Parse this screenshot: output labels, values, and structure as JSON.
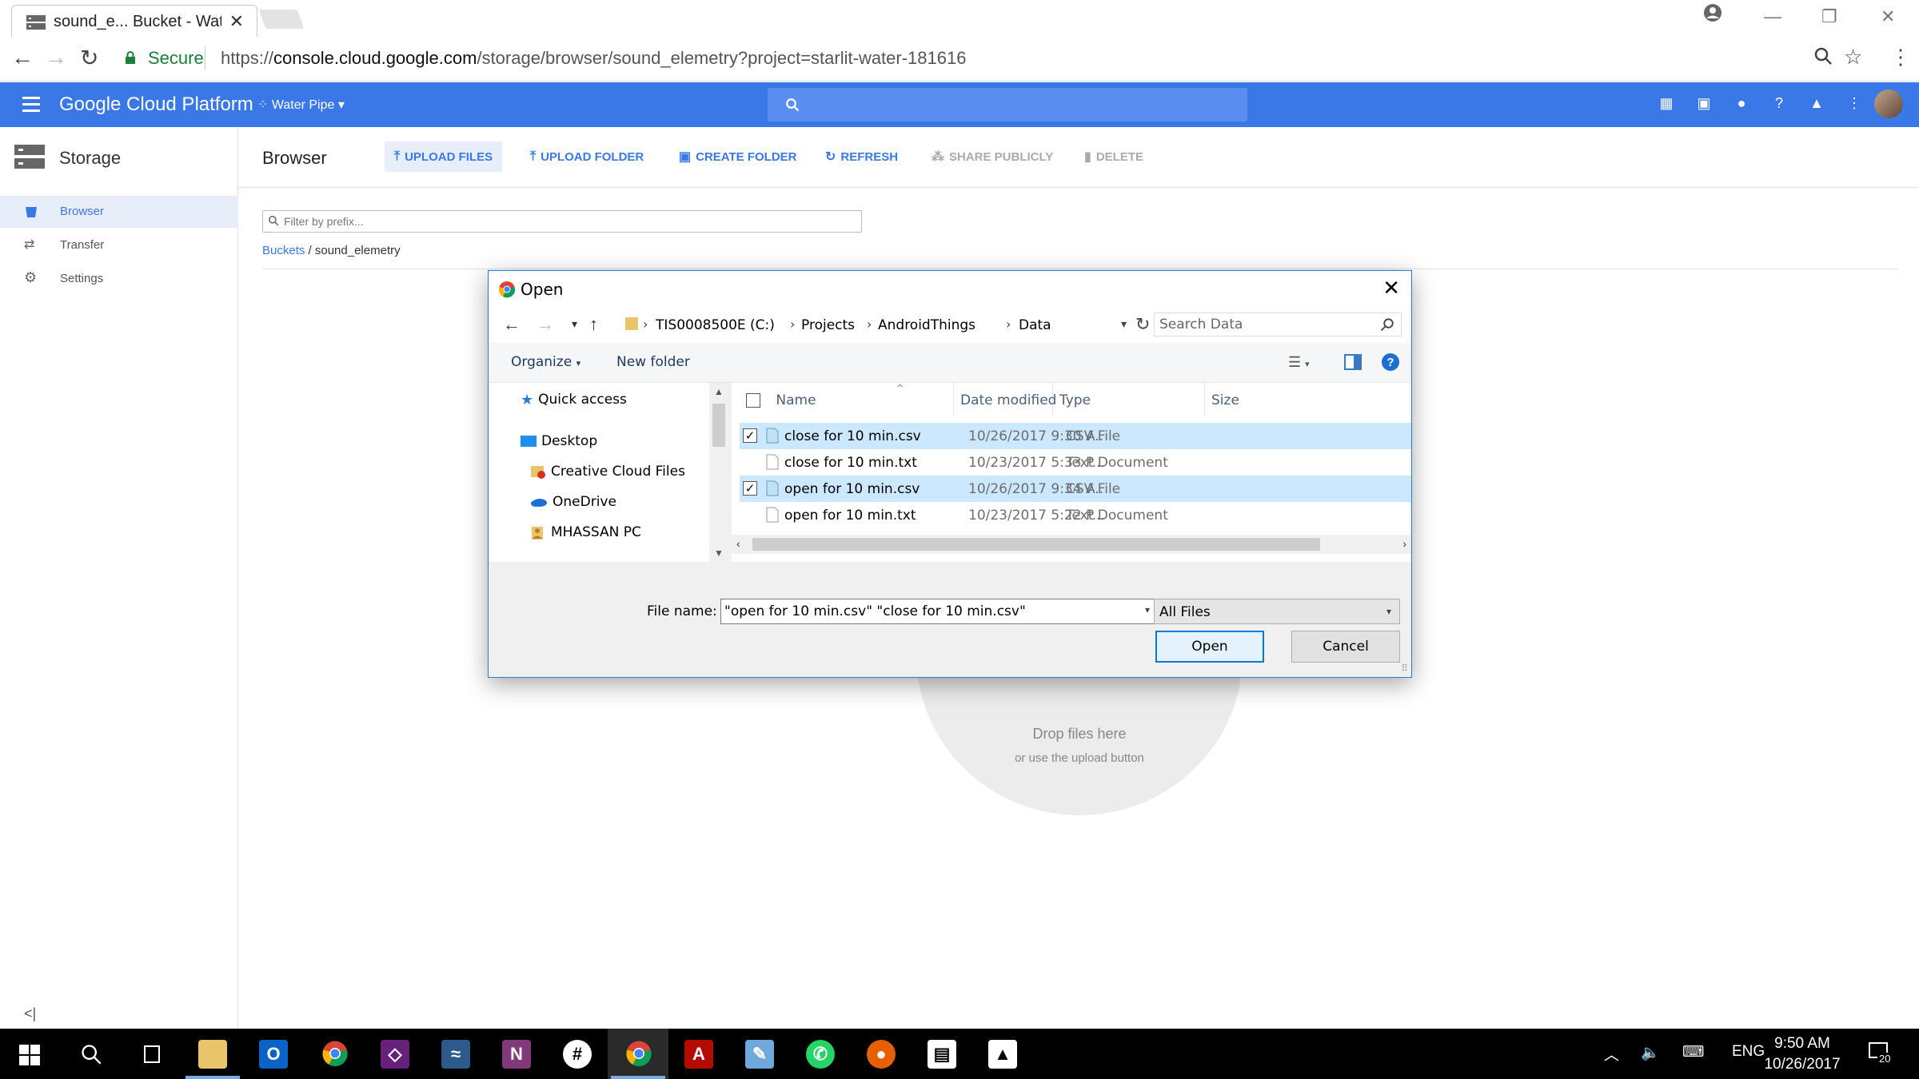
{
  "browser": {
    "tab_title": "sound_e... Bucket - Water",
    "omnibox": {
      "security_label": "Secure",
      "url_scheme": "https://",
      "url_host": "console.cloud.google.com",
      "url_path": "/storage/browser/sound_elemetry?project=starlit-water-181616"
    }
  },
  "gcp": {
    "product_name": "Google Cloud Platform",
    "project": "Water Pipe",
    "accent": "#3b78e7"
  },
  "sidebar": {
    "title": "Storage",
    "items": [
      {
        "label": "Browser",
        "icon": "bucket-icon",
        "active": true
      },
      {
        "label": "Transfer",
        "icon": "transfer-icon",
        "active": false
      },
      {
        "label": "Settings",
        "icon": "gear-icon",
        "active": false
      }
    ],
    "collapse": "<|"
  },
  "toolbar": {
    "title": "Browser",
    "upload_files": "UPLOAD FILES",
    "upload_folder": "UPLOAD FOLDER",
    "create_folder": "CREATE FOLDER",
    "refresh": "REFRESH",
    "share_publicly": "SHARE PUBLICLY",
    "delete": "DELETE"
  },
  "filter": {
    "placeholder": "Filter by prefix..."
  },
  "breadcrumb": {
    "root": "Buckets",
    "separator": "/",
    "current": "sound_elemetry"
  },
  "dropzone": {
    "title": "Drop files here",
    "subtitle": "or use the upload button"
  },
  "dialog": {
    "title": "Open",
    "path": [
      "TIS0008500E (C:)",
      "Projects",
      "AndroidThings",
      "Data"
    ],
    "search_placeholder": "Search Data",
    "organize": "Organize",
    "new_folder": "New folder",
    "nav_items": [
      {
        "label": "Quick access",
        "icon": "star-icon"
      },
      {
        "label": "Desktop",
        "icon": "desktop-icon"
      },
      {
        "label": "Creative Cloud Files",
        "icon": "creative-cloud-icon"
      },
      {
        "label": "OneDrive",
        "icon": "onedrive-icon"
      },
      {
        "label": "MHASSAN PC",
        "icon": "user-icon"
      }
    ],
    "columns": [
      "Name",
      "Date modified",
      "Type",
      "Size"
    ],
    "files": [
      {
        "name": "close for 10 min.csv",
        "date": "10/26/2017 9:30 A...",
        "type": "CSV File",
        "selected": true
      },
      {
        "name": "close for 10 min.txt",
        "date": "10/23/2017 5:33 P...",
        "type": "Text Document",
        "selected": false
      },
      {
        "name": "open for 10 min.csv",
        "date": "10/26/2017 9:34 A...",
        "type": "CSV File",
        "selected": true
      },
      {
        "name": "open for 10 min.txt",
        "date": "10/23/2017 5:22 P...",
        "type": "Text Document",
        "selected": false
      }
    ],
    "file_name_label": "File name:",
    "file_name_value": "\"open for 10 min.csv\" \"close for 10 min.csv\"",
    "file_type": "All Files",
    "open_button": "Open",
    "cancel_button": "Cancel"
  },
  "taskbar": {
    "language": "ENG",
    "time": "9:50 AM",
    "date": "10/26/2017",
    "notifications": "20"
  }
}
